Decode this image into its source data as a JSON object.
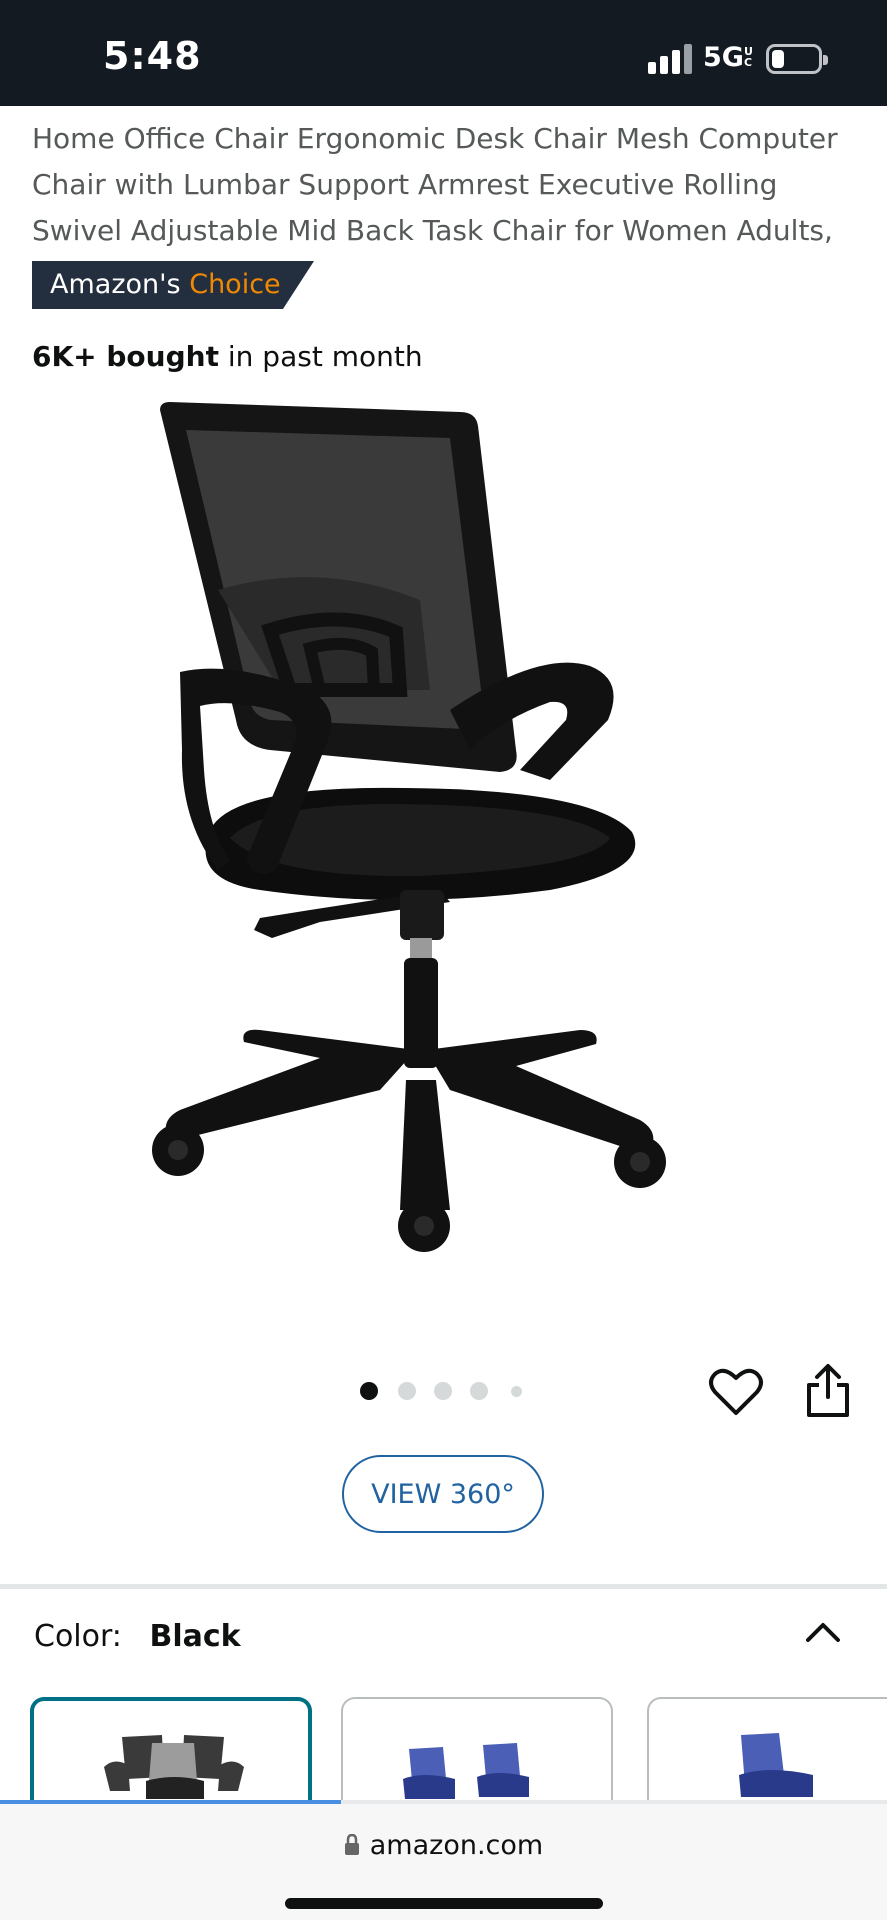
{
  "status_bar": {
    "time": "5:48",
    "network": "5G",
    "network_sub": "UC",
    "signal_bars": 4,
    "battery_level": 0.2
  },
  "product": {
    "title": "Home Office Chair Ergonomic Desk Chair Mesh Computer Chair with Lumbar Support Armrest Executive Rolling Swivel Adjustable Mid Back Task Chair for Women Adults, Black",
    "badge_prefix": "Amazon's",
    "badge_accent": "Choice",
    "bought_count": "6K+ bought",
    "bought_suffix": "in past month"
  },
  "gallery": {
    "image_count": 5,
    "active_index": 0,
    "view_360_label": "VIEW 360°",
    "icons": [
      "heart-icon",
      "share-icon"
    ]
  },
  "variation": {
    "label": "Color:",
    "selected_value": "Black",
    "swatches": [
      "Black",
      "Blue",
      "Blue"
    ]
  },
  "browser": {
    "url": "amazon.com",
    "load_progress": 0.385
  },
  "colors": {
    "status_bar_bg": "#131a22",
    "badge_bg": "#232f3e",
    "badge_accent": "#f08804",
    "link_blue": "#2162a1",
    "selected_swatch": "#007185"
  }
}
